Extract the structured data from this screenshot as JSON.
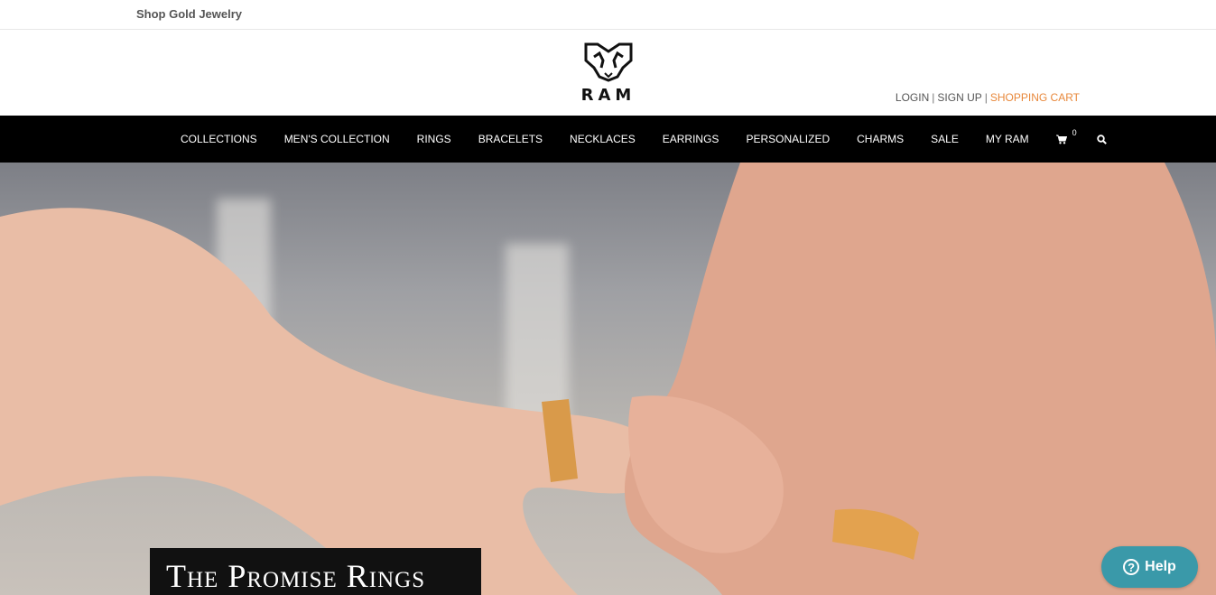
{
  "topbar": {
    "link": "Shop Gold Jewelry"
  },
  "brand": {
    "name": "RAM"
  },
  "account": {
    "login": "LOGIN",
    "separator": "|",
    "signup": "SIGN UP",
    "cart": "SHOPPING CART",
    "cart_color": "#e8883b"
  },
  "nav": {
    "items": [
      "COLLECTIONS",
      "MEN'S COLLECTION",
      "RINGS",
      "BRACELETS",
      "NECKLACES",
      "EARRINGS",
      "PERSONALIZED",
      "CHARMS",
      "SALE",
      "MY RAM"
    ],
    "cart_count": "0",
    "cart_icon": "shopping-cart-icon",
    "search_icon": "search-icon"
  },
  "hero": {
    "title": "The Promise Rings"
  },
  "help": {
    "label": "Help",
    "icon": "question-circle-icon",
    "color": "#3a99a9"
  }
}
